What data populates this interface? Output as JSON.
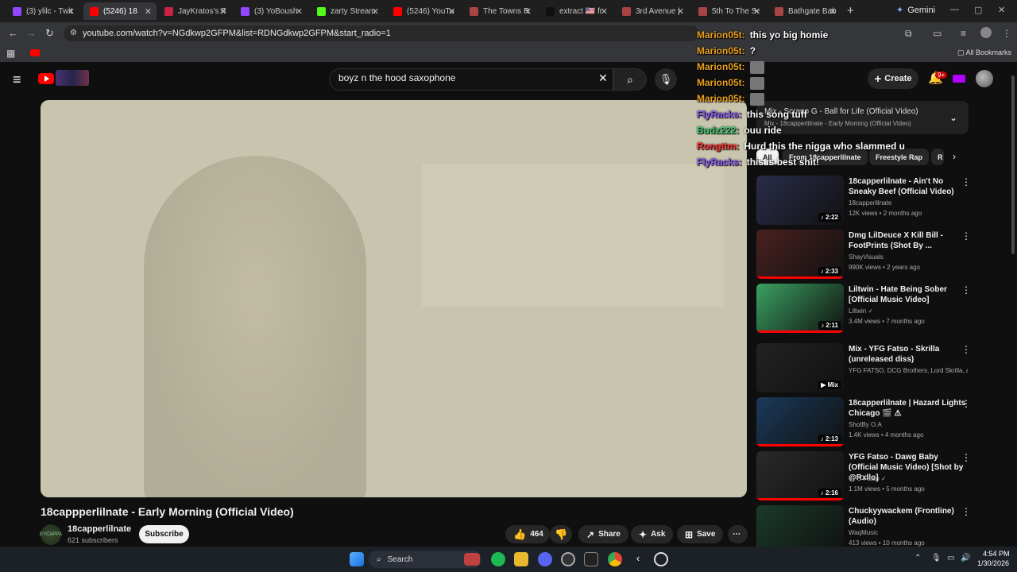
{
  "browser": {
    "tabs": [
      {
        "label": "(3) ylilc - Twit",
        "favcolor": "#9146ff"
      },
      {
        "label": "(5246) 18",
        "favcolor": "#ff0000",
        "active": true
      },
      {
        "label": "JayKratos's R",
        "favcolor": "#cc2244"
      },
      {
        "label": "(3) YoBoush",
        "favcolor": "#9146ff"
      },
      {
        "label": "zarty Stream",
        "favcolor": "#53fc18"
      },
      {
        "label": "(5246) YouTu",
        "favcolor": "#ff0000"
      },
      {
        "label": "The Towns R",
        "favcolor": "#aa4444"
      },
      {
        "label": "extract 🇺🇸 fr",
        "favcolor": "#111111"
      },
      {
        "label": "3rd Avenue |",
        "favcolor": "#aa4444"
      },
      {
        "label": "5th To The Se",
        "favcolor": "#aa4444"
      },
      {
        "label": "Bathgate Bab",
        "favcolor": "#aa4444"
      }
    ],
    "new_tab": "+",
    "gemini_label": "Gemini",
    "url": "youtube.com/watch?v=NGdkwp2GFPM&list=RDNGdkwp2GFPM&start_radio=1",
    "all_bookmarks": "All Bookmarks"
  },
  "youtube": {
    "search_value": "boyz n the hood saxophone",
    "create_label": "Create",
    "notif_badge": "9+",
    "video_title": "18cappperlilnate - Early Morning (Official Video)",
    "channel_name": "18capperlilnate",
    "channel_avatar_text": "EYCAPPA",
    "channel_subs": "621 subscribers",
    "subscribe_label": "Subscribe",
    "like_count": "464",
    "share_label": "Share",
    "ask_label": "Ask",
    "save_label": "Save",
    "upnext_title": "Mix - Scrapp G - Ball for Life (Official Video)",
    "upnext_sub": "Mix - 18capperlilnate - Early Morning (Official Video)",
    "chips": [
      "All",
      "From 18capperlilnate",
      "Freestyle Rap",
      "R"
    ],
    "recs": [
      {
        "title": "18capperlilnate - Ain't No Sneaky Beef (Official Video)",
        "channel": "18capperlilnate",
        "meta": "12K views • 2 months ago",
        "dur": "♪ 2:22",
        "thumb": "#2a2d4a",
        "bar": 0.0
      },
      {
        "title": "Dmg LilDeuce X Kill Bill - FootPrints (Shot By ...",
        "channel": "ShayVisuals",
        "meta": "990K views • 2 years ago",
        "dur": "♪ 2:33",
        "thumb": "#4a2020",
        "bar": 1.0
      },
      {
        "title": "Liltwin - Hate Being Sober [Official Music Video]",
        "channel": "Liltwin ✓",
        "meta": "3.4M views • 7 months ago",
        "dur": "♪ 2:11",
        "thumb": "#3aa060",
        "bar": 1.0
      },
      {
        "title": "Mix - YFG Fatso - Skrilla (unreleased diss)",
        "channel": "YFG FATSO, DCG Brothers, Lord Skrilla, a...",
        "meta": "",
        "dur": "▶ Mix",
        "thumb": "#222222",
        "bar": 0.0
      },
      {
        "title": "18capperlilnate | Hazard Lights Chicago 🎬 ⚠",
        "channel": "ShotBy O.A",
        "meta": "1.4K views • 4 months ago",
        "dur": "♪ 2:13",
        "thumb": "#1a3a5a",
        "bar": 1.0
      },
      {
        "title": "YFG Fatso - Dawg Baby (Official Music Video) [Shot by @Rxllo]",
        "channel": "YFG Fatso ✓",
        "meta": "1.1M views • 5 months ago",
        "dur": "♪ 2:16",
        "thumb": "#2a2a2a",
        "bar": 1.0
      },
      {
        "title": "Chuckyywackem (Frontline) (Audio)",
        "channel": "WaqMusic",
        "meta": "413 views • 10 months ago",
        "dur": "",
        "thumb": "#1a3a2a",
        "bar": 0.0
      }
    ]
  },
  "chat": [
    {
      "user": "Marion05t:",
      "color": "#e8a020",
      "msg": "this yo big homie",
      "emote": false
    },
    {
      "user": "Marion05t:",
      "color": "#e8a020",
      "msg": "?",
      "emote": false
    },
    {
      "user": "Marion05t:",
      "color": "#e8a020",
      "msg": "",
      "emote": true
    },
    {
      "user": "Marion05t:",
      "color": "#e8a020",
      "msg": "",
      "emote": true
    },
    {
      "user": "Marion05t:",
      "color": "#e8a020",
      "msg": "",
      "emote": true
    },
    {
      "user": "FlyRacks:",
      "color": "#8a5cff",
      "msg": "this song tuff",
      "emote": false
    },
    {
      "user": "Budz222:",
      "color": "#3ad070",
      "msg": "ouu ride",
      "emote": false
    },
    {
      "user": "Rongttm:",
      "color": "#ff3030",
      "msg": "Hurd this the nigga who slammed u",
      "emote": false
    },
    {
      "user": "FlyRacks:",
      "color": "#8a5cff",
      "msg": "this is best shit!",
      "emote": false
    }
  ],
  "taskbar": {
    "search_label": "Search",
    "time": "4:54 PM",
    "date": "1/30/2026"
  },
  "icons": {
    "back": "back-arrow-icon",
    "forward": "forward-arrow-icon",
    "reload": "reload-icon",
    "like": "thumbs-up-icon",
    "dislike": "thumbs-down-icon",
    "share": "share-icon",
    "ask": "sparkle-icon",
    "save": "bookmark-icon",
    "more": "more-icon"
  }
}
